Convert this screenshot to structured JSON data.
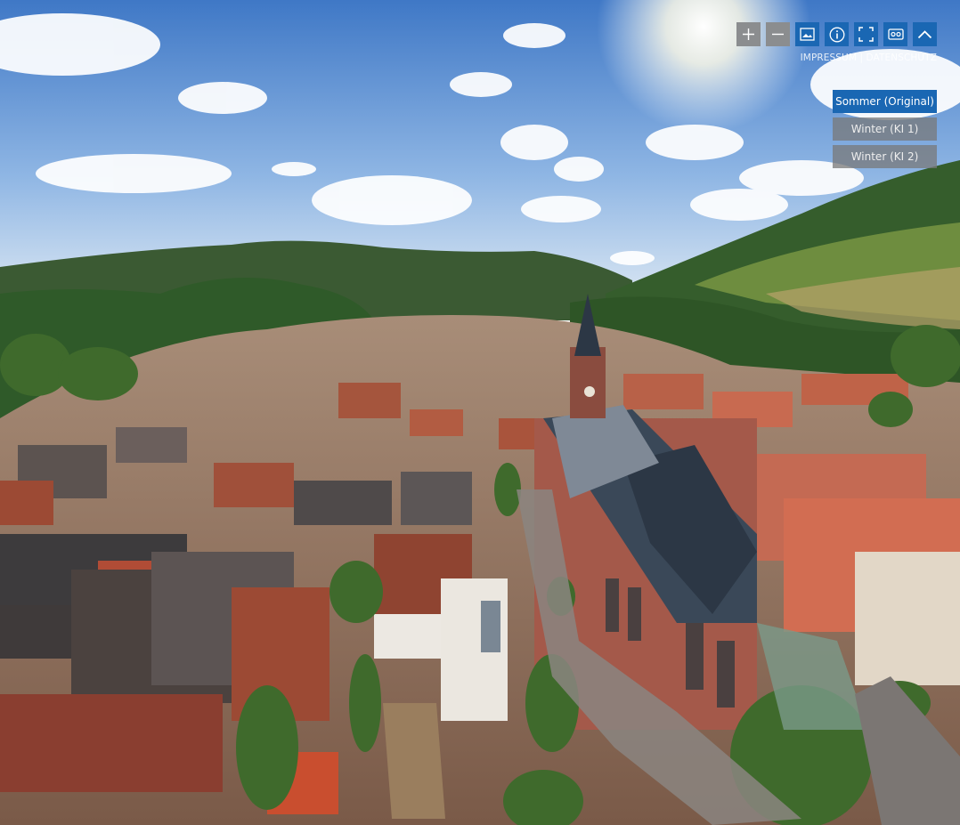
{
  "toolbar": {
    "buttons": [
      {
        "icon": "plus-icon",
        "style": "grey"
      },
      {
        "icon": "minus-icon",
        "style": "grey"
      },
      {
        "icon": "image-icon",
        "style": "blue"
      },
      {
        "icon": "info-icon",
        "style": "blue"
      },
      {
        "icon": "fullscreen-icon",
        "style": "blue"
      },
      {
        "icon": "vr-glasses-icon",
        "style": "blue"
      },
      {
        "icon": "chevron-up-icon",
        "style": "blue"
      }
    ]
  },
  "footer": {
    "impressum": "IMPRESSUM",
    "separator": " | ",
    "datenschutz": "DATENSCHUTZ"
  },
  "variants": [
    {
      "label": "Sommer (Original)",
      "active": true
    },
    {
      "label": "Winter (KI 1)",
      "active": false
    },
    {
      "label": "Winter (KI 2)",
      "active": false
    }
  ],
  "colors": {
    "accent": "#1a67b3",
    "button_grey": "#8b8d8f"
  }
}
